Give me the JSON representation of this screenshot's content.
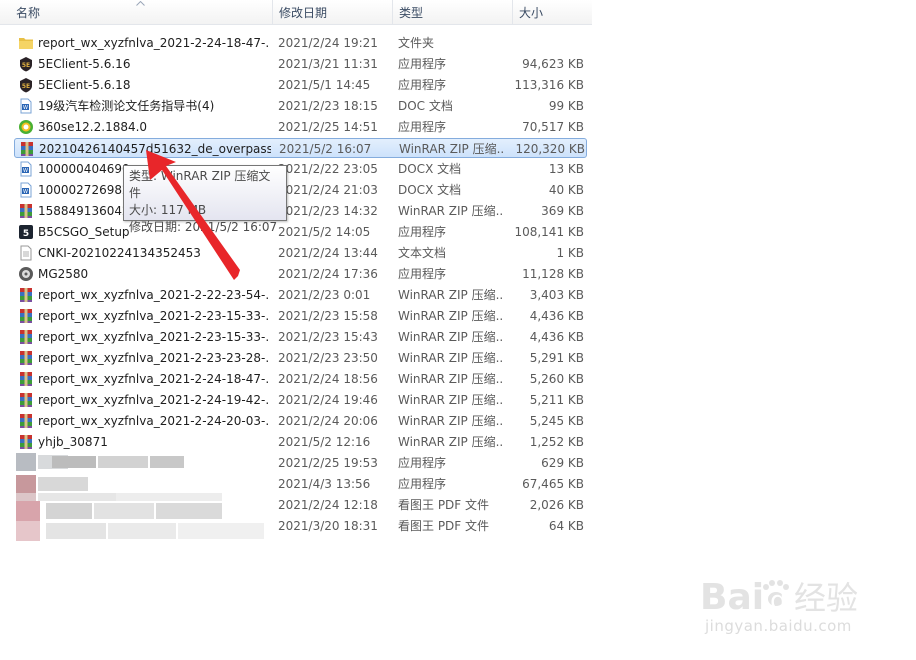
{
  "header": {
    "name": "名称",
    "date": "修改日期",
    "type": "类型",
    "size": "大小"
  },
  "files": [
    {
      "name": "report_wx_xyzfnlva_2021-2-24-18-47-...",
      "date": "2021/2/24 19:21",
      "type": "文件夹",
      "size": "",
      "icon": "folder-icon"
    },
    {
      "name": "5EClient-5.6.16",
      "date": "2021/3/21 11:31",
      "type": "应用程序",
      "size": "94,623 KB",
      "icon": "5e-client-icon"
    },
    {
      "name": "5EClient-5.6.18",
      "date": "2021/5/1 14:45",
      "type": "应用程序",
      "size": "113,316 KB",
      "icon": "5e-client-icon"
    },
    {
      "name": "19级汽车检测论文任务指导书(4)",
      "date": "2021/2/23 18:15",
      "type": "DOC 文档",
      "size": "99 KB",
      "icon": "word-doc-icon"
    },
    {
      "name": "360se12.2.1884.0",
      "date": "2021/2/25 14:51",
      "type": "应用程序",
      "size": "70,517 KB",
      "icon": "360-browser-icon"
    },
    {
      "name": "20210426140457d51632_de_overpass",
      "date": "2021/5/2 16:07",
      "type": "WinRAR ZIP 压缩...",
      "size": "120,320 KB",
      "icon": "winrar-icon"
    },
    {
      "name": "100000404690",
      "date": "2021/2/22 23:05",
      "type": "DOCX 文档",
      "size": "13 KB",
      "icon": "word-doc-icon"
    },
    {
      "name": "100002726982",
      "date": "2021/2/24 21:03",
      "type": "DOCX 文档",
      "size": "40 KB",
      "icon": "word-doc-icon"
    },
    {
      "name": "158849136042",
      "date": "2021/2/23 14:32",
      "type": "WinRAR ZIP 压缩...",
      "size": "369 KB",
      "icon": "winrar-icon"
    },
    {
      "name": "B5CSGO_Setup",
      "date": "2021/5/2 14:05",
      "type": "应用程序",
      "size": "108,141 KB",
      "icon": "b5-icon"
    },
    {
      "name": "CNKI-20210224134352453",
      "date": "2021/2/24 13:44",
      "type": "文本文档",
      "size": "1 KB",
      "icon": "text-file-icon"
    },
    {
      "name": "MG2580",
      "date": "2021/2/24 17:36",
      "type": "应用程序",
      "size": "11,128 KB",
      "icon": "installer-icon"
    },
    {
      "name": "report_wx_xyzfnlva_2021-2-22-23-54-...",
      "date": "2021/2/23 0:01",
      "type": "WinRAR ZIP 压缩...",
      "size": "3,403 KB",
      "icon": "winrar-icon"
    },
    {
      "name": "report_wx_xyzfnlva_2021-2-23-15-33-...",
      "date": "2021/2/23 15:58",
      "type": "WinRAR ZIP 压缩...",
      "size": "4,436 KB",
      "icon": "winrar-icon"
    },
    {
      "name": "report_wx_xyzfnlva_2021-2-23-15-33-...",
      "date": "2021/2/23 15:43",
      "type": "WinRAR ZIP 压缩...",
      "size": "4,436 KB",
      "icon": "winrar-icon"
    },
    {
      "name": "report_wx_xyzfnlva_2021-2-23-23-28-...",
      "date": "2021/2/23 23:50",
      "type": "WinRAR ZIP 压缩...",
      "size": "5,291 KB",
      "icon": "winrar-icon"
    },
    {
      "name": "report_wx_xyzfnlva_2021-2-24-18-47-...",
      "date": "2021/2/24 18:56",
      "type": "WinRAR ZIP 压缩...",
      "size": "5,260 KB",
      "icon": "winrar-icon"
    },
    {
      "name": "report_wx_xyzfnlva_2021-2-24-19-42-...",
      "date": "2021/2/24 19:46",
      "type": "WinRAR ZIP 压缩...",
      "size": "5,211 KB",
      "icon": "winrar-icon"
    },
    {
      "name": "report_wx_xyzfnlva_2021-2-24-20-03-...",
      "date": "2021/2/24 20:06",
      "type": "WinRAR ZIP 压缩...",
      "size": "5,245 KB",
      "icon": "winrar-icon"
    },
    {
      "name": "yhjb_30871",
      "date": "2021/5/2 12:16",
      "type": "WinRAR ZIP 压缩...",
      "size": "1,252 KB",
      "icon": "winrar-icon"
    },
    {
      "name": "",
      "date": "2021/2/25 19:53",
      "type": "应用程序",
      "size": "629 KB",
      "icon": "blurred-icon"
    },
    {
      "name": "",
      "date": "2021/4/3 13:56",
      "type": "应用程序",
      "size": "67,465 KB",
      "icon": "blurred-icon"
    },
    {
      "name": "",
      "date": "2021/2/24 12:18",
      "type": "看图王 PDF 文件",
      "size": "2,026 KB",
      "icon": "blurred-icon"
    },
    {
      "name": "",
      "date": "2021/3/20 18:31",
      "type": "看图王 PDF 文件",
      "size": "64 KB",
      "icon": "blurred-icon"
    }
  ],
  "selected_index": 5,
  "tooltip": {
    "type_line": "类型: WinRAR ZIP 压缩文件",
    "size_line": "大小: 117 MB",
    "date_line": "修改日期: 2021/5/2 16:07"
  },
  "watermark": {
    "brand_latin": "Bai",
    "brand_paw": "du",
    "brand_cn": "经验",
    "site": "jingyan.baidu.com"
  },
  "colors": {
    "selection_border": "#84acdd",
    "arrow": "#e8262a",
    "header_text": "#3a4b63"
  }
}
